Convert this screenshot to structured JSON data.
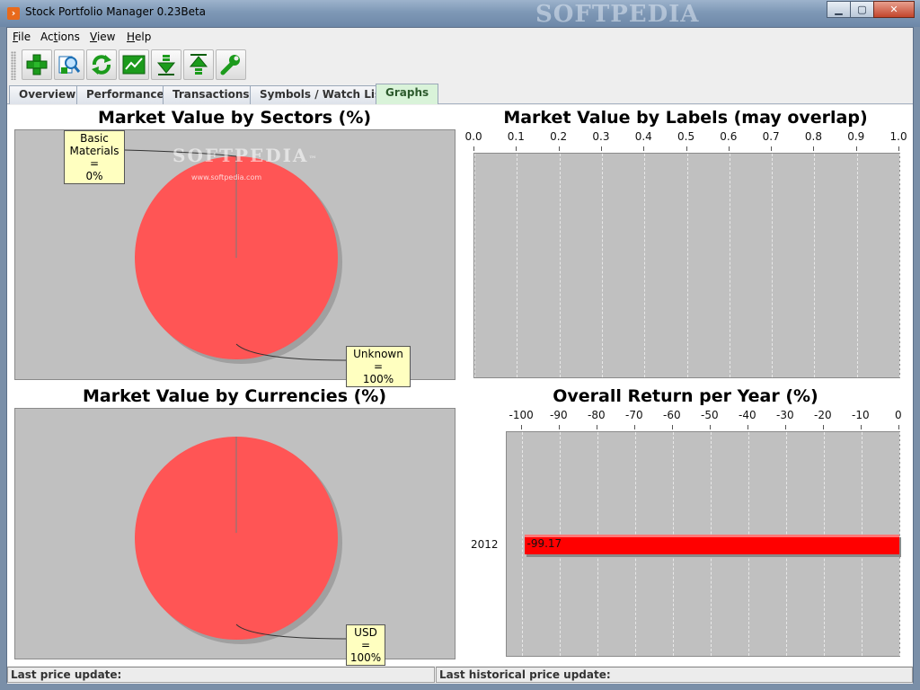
{
  "window": {
    "title": "Stock Portfolio Manager 0.23Beta",
    "watermark": "SOFTPEDIA",
    "minimize": "▁",
    "maximize": "▢",
    "close": "✕"
  },
  "menu": {
    "file": "F",
    "file_rest": "ile",
    "actions_pre": "Ac",
    "actions_u": "t",
    "actions_post": "ions",
    "view": "V",
    "view_rest": "iew",
    "help": "H",
    "help_rest": "elp"
  },
  "toolbar": {
    "buttons": [
      {
        "icon": "add-plus-icon"
      },
      {
        "icon": "search-magnifier-icon"
      },
      {
        "icon": "refresh-icon"
      },
      {
        "icon": "chart-line-icon"
      },
      {
        "icon": "download-arrow-icon"
      },
      {
        "icon": "upload-arrow-icon"
      },
      {
        "icon": "settings-wrench-icon"
      }
    ]
  },
  "tabs": [
    {
      "label": "Overview"
    },
    {
      "label": "Performance"
    },
    {
      "label": "Transactions"
    },
    {
      "label": "Symbols / Watch List"
    },
    {
      "label": "Graphs",
      "active": true
    }
  ],
  "watermark": {
    "text": "SOFTPEDIA",
    "tm": "™",
    "url": "www.softpedia.com"
  },
  "charts": {
    "sectors": {
      "title": "Market Value by Sectors (%)",
      "label_a_line1": "Basic",
      "label_a_line2": "Materials =",
      "label_a_line3": "0%",
      "label_b_line1": "Unknown =",
      "label_b_line2": "100%"
    },
    "labels": {
      "title": "Market Value by Labels (may overlap)"
    },
    "currencies": {
      "title": "Market Value by Currencies (%)",
      "label_line1": "USD =",
      "label_line2": "100%"
    },
    "returns": {
      "title": "Overall Return per Year (%)",
      "bar_label": "-99.17",
      "category": "2012"
    }
  },
  "chart_data": [
    {
      "type": "pie",
      "title": "Market Value by Sectors (%)",
      "labels": [
        "Basic Materials",
        "Unknown"
      ],
      "values": [
        0,
        100
      ],
      "colors": [
        "#ff5555",
        "#ff5555"
      ]
    },
    {
      "type": "bar",
      "title": "Market Value by Labels (may overlap)",
      "orientation": "horizontal",
      "categories": [],
      "values": [],
      "xlim": [
        0.0,
        1.0
      ],
      "xticks": [
        "0.0",
        "0.1",
        "0.2",
        "0.3",
        "0.4",
        "0.5",
        "0.6",
        "0.7",
        "0.8",
        "0.9",
        "1.0"
      ]
    },
    {
      "type": "pie",
      "title": "Market Value by Currencies (%)",
      "labels": [
        "USD"
      ],
      "values": [
        100
      ],
      "colors": [
        "#ff5555"
      ]
    },
    {
      "type": "bar",
      "title": "Overall Return per Year (%)",
      "orientation": "horizontal",
      "categories": [
        "2012"
      ],
      "values": [
        -99.17
      ],
      "xlim": [
        -100,
        0
      ],
      "xticks": [
        "-100",
        "-90",
        "-80",
        "-70",
        "-60",
        "-50",
        "-40",
        "-30",
        "-20",
        "-10",
        "0"
      ],
      "bar_color": "#ff0000"
    }
  ],
  "status": {
    "left": "Last price update:",
    "right": "Last historical price update:"
  }
}
